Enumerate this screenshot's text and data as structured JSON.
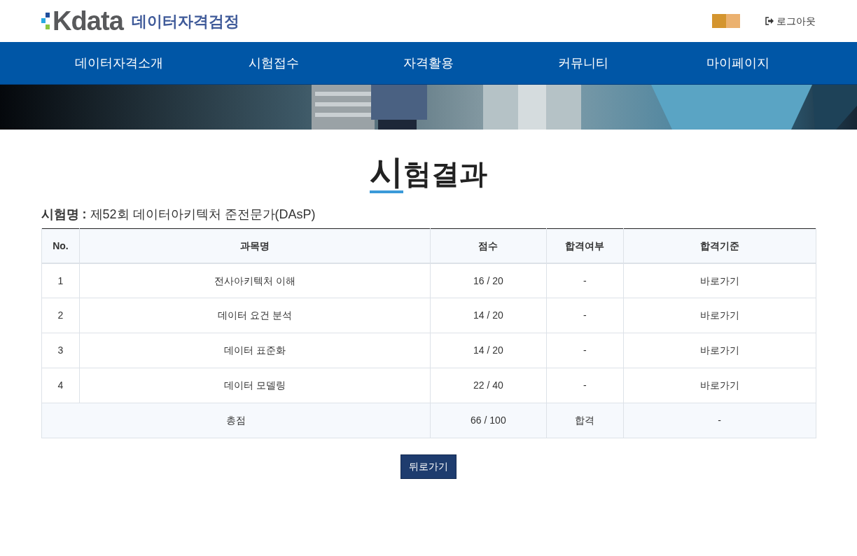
{
  "header": {
    "logo": "Kdata",
    "logo_subtitle": "데이터자격검정",
    "logout": "로그아웃"
  },
  "nav": [
    "데이터자격소개",
    "시험접수",
    "자격활용",
    "커뮤니티",
    "마이페이지"
  ],
  "page_title": "시험결과",
  "exam_name": "**시험명 :** 제52회 데이터아키텍처 준전문가(DAsP)",
  "table": {
    "columns": [
      "No.",
      "과목명",
      "점수",
      "합격여부",
      "합격기준"
    ],
    "rows": [
      {
        "no": "1",
        "subject": "전사아키텍처 이해",
        "score": "16 / 20",
        "pass": "-",
        "criteria": "바로가기"
      },
      {
        "no": "2",
        "subject": "데이터 요건 분석",
        "score": "14 / 20",
        "pass": "-",
        "criteria": "바로가기"
      },
      {
        "no": "3",
        "subject": "데이터 표준화",
        "score": "14 / 20",
        "pass": "-",
        "criteria": "바로가기"
      },
      {
        "no": "4",
        "subject": "데이터 모델링",
        "score": "22 / 40",
        "pass": "-",
        "criteria": "바로가기"
      }
    ],
    "total": {
      "label": "총점",
      "score": "66 / 100",
      "pass": "합격",
      "criteria": "-"
    }
  },
  "back_button": "뒤로가기"
}
